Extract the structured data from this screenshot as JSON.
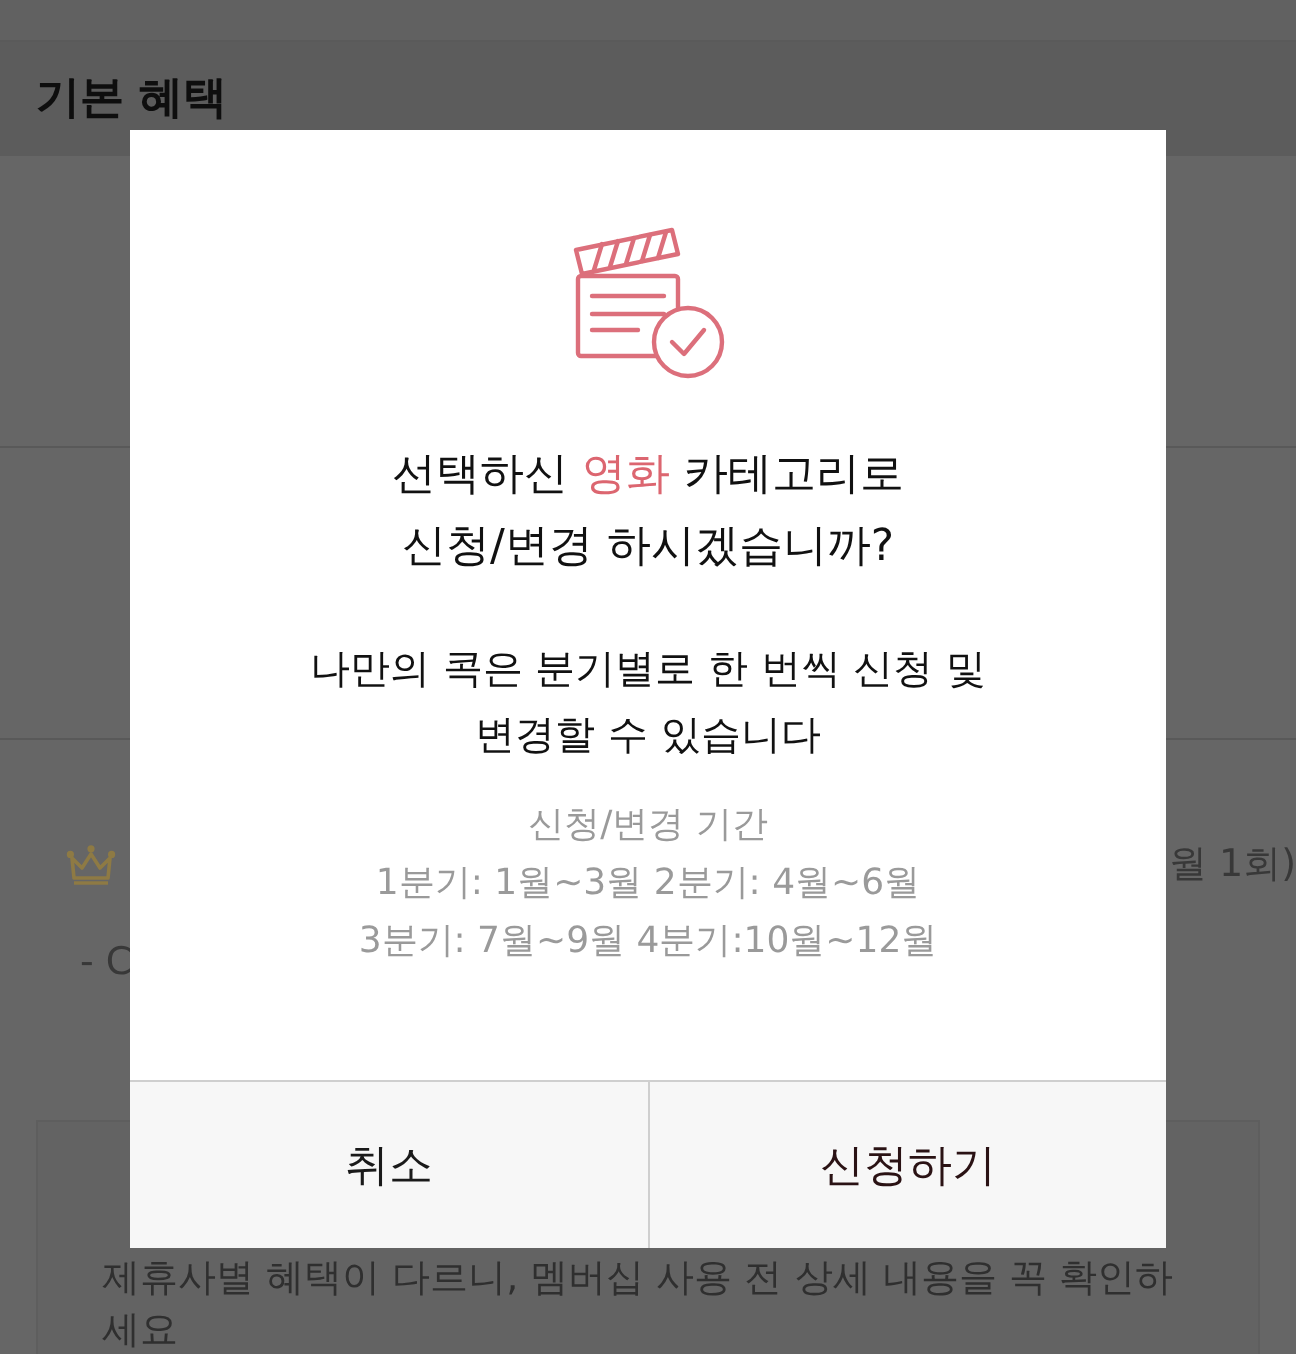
{
  "page": {
    "section_title": "기본 혜택",
    "benefit": {
      "trailing_text": "월 1회)",
      "detail_text": "- C"
    },
    "notice_card": {
      "body": "제휴사별 혜택이 다르니, 멤버십 사용 전 상세 내용을 꼭 확인하\n세요"
    }
  },
  "dialog": {
    "question": {
      "before": "선택하신 ",
      "highlight": "영화",
      "after": " 카테고리로\n신청/변경 하시겠습니까?"
    },
    "notice": "나만의 콕은 분기별로 한 번씩 신청 및\n변경할 수 있습니다",
    "period": {
      "title": "신청/변경 기간",
      "lines": [
        "1분기: 1월~3월 2분기: 4월~6월",
        "3분기: 7월~9월 4분기:10월~12월"
      ]
    },
    "buttons": [
      {
        "label": "취소",
        "kind": "cancel"
      },
      {
        "label": "신청하기",
        "kind": "confirm"
      }
    ]
  }
}
